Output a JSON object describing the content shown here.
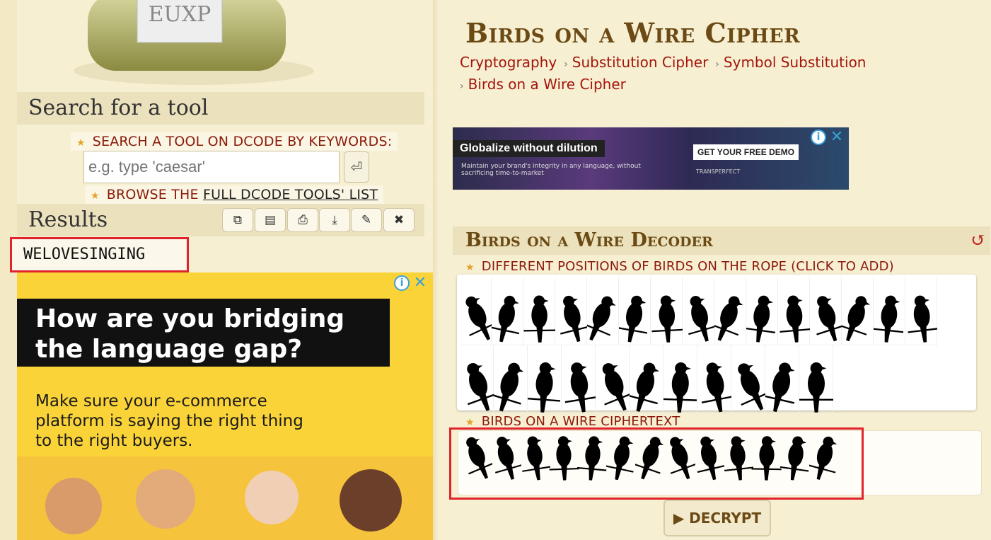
{
  "sidebar": {
    "search_section_title": "Search for a tool",
    "search_label": "SEARCH A TOOL ON DCODE BY KEYWORDS:",
    "search_placeholder": "e.g. type 'caesar'",
    "browse_prefix": "BROWSE THE ",
    "browse_link": "FULL DCODE TOOLS' LIST",
    "results_title": "Results",
    "result_value": "WELOVESINGING",
    "toolbar_icons": [
      "copy-icon",
      "print-preview-icon",
      "print-icon",
      "download-icon",
      "pin-icon",
      "close-icon"
    ]
  },
  "ad_left": {
    "headline": "How are you bridging the language gap?",
    "body": "Make sure your e-commerce platform is saying the right thing to the right buyers."
  },
  "page": {
    "title": "Birds on a Wire Cipher",
    "breadcrumb": [
      "Cryptography",
      "Substitution Cipher",
      "Symbol Substitution",
      "Birds on a Wire Cipher"
    ]
  },
  "ad_top": {
    "headline": "Globalize without dilution",
    "subtext": "Maintain your brand's integrity in any language, without sacrificing time-to-market",
    "cta": "GET YOUR FREE DEMO",
    "brand": "TRANSPERFECT"
  },
  "decoder": {
    "title": "Birds on a Wire Decoder",
    "positions_label": "DIFFERENT POSITIONS OF BIRDS ON THE ROPE (CLICK TO ADD)",
    "ciphertext_label": "BIRDS ON A WIRE CIPHERTEXT",
    "decrypt_label": "▶ DECRYPT",
    "palette_count": 26,
    "ciphertext_count": 13
  }
}
